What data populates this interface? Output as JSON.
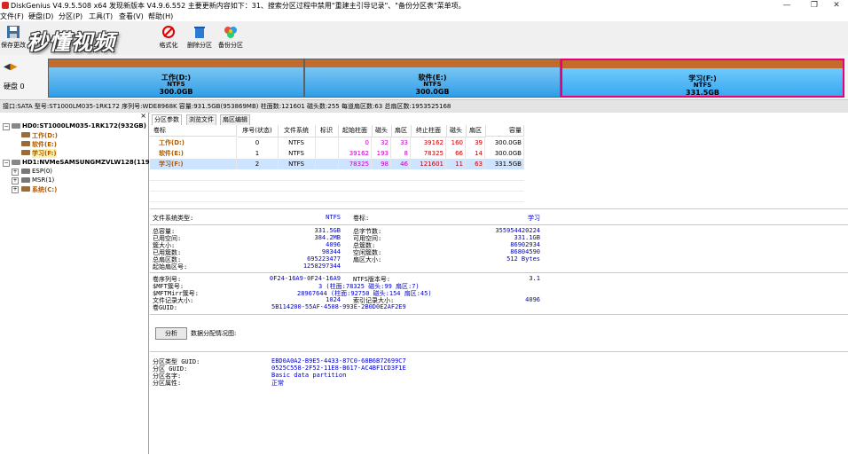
{
  "window": {
    "title": "DiskGenius V4.9.5.508 x64   发现新版本 V4.9.6.552 主要更新内容如下：31、搜索分区过程中禁用\"重建主引导记录\"、\"备份分区表\"菜单项。",
    "minimize": "—",
    "maximize": "❐",
    "close": "✕"
  },
  "menu": [
    "文件(F)",
    "硬盘(D)",
    "分区(P)",
    "工具(T)",
    "查看(V)",
    "帮助(H)"
  ],
  "toolbar": {
    "save_label": "保存更改",
    "format_label": "格式化",
    "delete_label": "删除分区",
    "backup_label": "备份分区",
    "logo_text": "秒懂视频"
  },
  "disk": {
    "label": "硬盘 0",
    "nav_left": "◀",
    "nav_right": "▶",
    "partitions": [
      {
        "name": "工作(D:)",
        "fs": "NTFS",
        "size": "300.0GB"
      },
      {
        "name": "软件(E:)",
        "fs": "NTFS",
        "size": "300.0GB"
      },
      {
        "name": "学习(F:)",
        "fs": "NTFS",
        "size": "331.5GB"
      }
    ],
    "info": "接口:SATA  型号:ST1000LM035-1RK172  序列号:WDE8968K  容量:931.5GB(953869MB)  柱面数:121601  磁头数:255  每道扇区数:63  总扇区数:1953525168"
  },
  "tree": {
    "close": "×",
    "items": [
      {
        "exp": "−",
        "text": "HD0:ST1000LM035-1RK172(932GB)"
      },
      {
        "exp": "",
        "text": "工作(D:)"
      },
      {
        "exp": "",
        "text": "软件(E:)"
      },
      {
        "exp": "",
        "text": "学习(F:)"
      },
      {
        "exp": "−",
        "text": "HD1:NVMeSAMSUNGMZVLW128(119GB)"
      },
      {
        "exp": "+",
        "text": "ESP(0)"
      },
      {
        "exp": "+",
        "text": "MSR(1)"
      },
      {
        "exp": "+",
        "text": "系统(C:)"
      }
    ]
  },
  "tabs": [
    "分区参数",
    "浏览文件",
    "扇区编辑"
  ],
  "table": {
    "headers": [
      "卷标",
      "序号(状态)",
      "文件系统",
      "标识",
      "起始柱面",
      "磁头",
      "扇区",
      "终止柱面",
      "磁头",
      "扇区",
      "容量"
    ],
    "rows": [
      [
        "工作(D:)",
        "0",
        "NTFS",
        "",
        "0",
        "32",
        "33",
        "39162",
        "160",
        "39",
        "300.0GB"
      ],
      [
        "软件(E:)",
        "1",
        "NTFS",
        "",
        "39162",
        "193",
        "8",
        "78325",
        "66",
        "14",
        "300.0GB"
      ],
      [
        "学习(F:)",
        "2",
        "NTFS",
        "",
        "78325",
        "98",
        "46",
        "121601",
        "11",
        "63",
        "331.5GB"
      ]
    ]
  },
  "details": {
    "fs_type_label": "文件系统类型:",
    "fs_type_value": "NTFS",
    "vol_label": "卷标:",
    "vol_value": "学习",
    "left1": [
      [
        "总容量:",
        "331.5GB"
      ],
      [
        "已用空间:",
        "384.2MB"
      ],
      [
        "簇大小:",
        "4096"
      ],
      [
        "已用簇数:",
        "98344"
      ],
      [
        "总扇区数:",
        "695223477"
      ],
      [
        "起始扇区号:",
        "1258297344"
      ]
    ],
    "right1": [
      [
        "总字节数:",
        "355954420224"
      ],
      [
        "可用空间:",
        "331.1GB"
      ],
      [
        "总簇数:",
        "86902934"
      ],
      [
        "空闲簇数:",
        "86804590"
      ],
      [
        "扇区大小:",
        "512 Bytes"
      ]
    ],
    "left2": [
      [
        "卷序列号:",
        "0F24-16A9-0F24-16A9"
      ],
      [
        "$MFT簇号:",
        "3 (柱面:78325 磁头:99 扇区:7)"
      ],
      [
        "$MFTMirr簇号:",
        "28967644 (柱面:92750 磁头:154 扇区:45)"
      ],
      [
        "文件记录大小:",
        "1024"
      ],
      [
        "卷GUID:",
        "5B114200-55AF-4508-993E-2B0D0E2AF2E9"
      ]
    ],
    "right2": [
      [
        "NTFS版本号:",
        "3.1"
      ],
      [
        "",
        ""
      ],
      [
        "",
        ""
      ],
      [
        "索引记录大小:",
        "4096"
      ]
    ],
    "analyze_label": "分析",
    "allocation_label": "数据分配情况图:",
    "guid_rows": [
      [
        "分区类型 GUID:",
        "EBD0A0A2-B9E5-4433-87C0-68B6B72699C7"
      ],
      [
        "分区 GUID:",
        "0525C558-2F52-11E8-B617-AC4BF1CD3F1E"
      ],
      [
        "分区名字:",
        "Basic data partition"
      ],
      [
        "分区属性:",
        "正常"
      ]
    ]
  }
}
